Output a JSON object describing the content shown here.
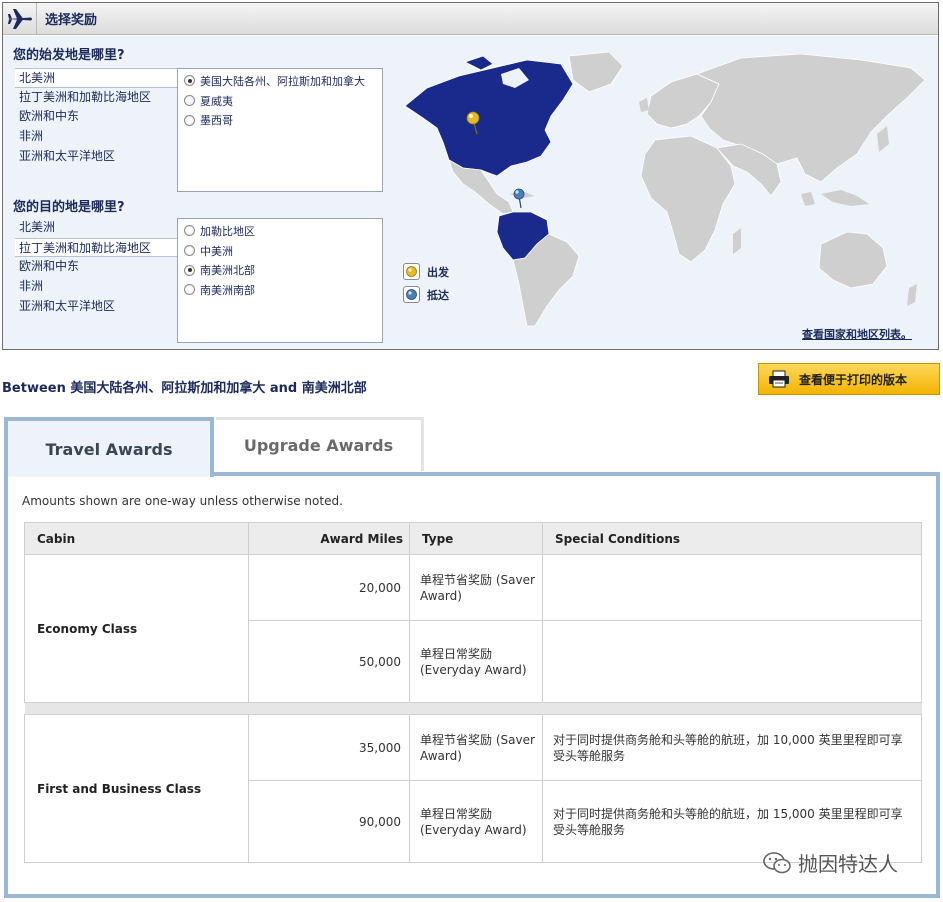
{
  "selector": {
    "title": "选择奖励",
    "origin_question": "您的始发地是哪里?",
    "origin_regions": [
      "北美洲",
      "拉丁美洲和加勒比海地区",
      "欧洲和中东",
      "非洲",
      "亚洲和太平洋地区"
    ],
    "origin_options": [
      {
        "label": "美国大陆各州、阿拉斯加和加拿大",
        "checked": true
      },
      {
        "label": "夏威夷",
        "checked": false
      },
      {
        "label": "墨西哥",
        "checked": false
      }
    ],
    "dest_question": "您的目的地是哪里?",
    "dest_regions": [
      "北美洲",
      "拉丁美洲和加勒比海地区",
      "欧洲和中东",
      "非洲",
      "亚洲和太平洋地区"
    ],
    "dest_options": [
      {
        "label": "加勒比地区",
        "checked": false
      },
      {
        "label": "中美洲",
        "checked": false
      },
      {
        "label": "南美洲北部",
        "checked": true
      },
      {
        "label": "南美洲南部",
        "checked": false
      }
    ],
    "legend": {
      "depart": "出发",
      "arrive": "抵达"
    },
    "country_list_link": "查看国家和地区列表。",
    "colors": {
      "highlight": "#1a2a8c",
      "land": "#cfcfcf",
      "depart_pin": "#e2b92a",
      "arrive_pin": "#4a80b8"
    }
  },
  "route": "Between 美国大陆各州、阿拉斯加和加拿大 and 南美洲北部",
  "print_button": "查看便于打印的版本",
  "tabs": [
    {
      "label": "Travel Awards",
      "active": true
    },
    {
      "label": "Upgrade Awards",
      "active": false
    }
  ],
  "note": "Amounts shown are one-way unless otherwise noted.",
  "table": {
    "headers": {
      "cabin": "Cabin",
      "miles": "Award Miles",
      "type": "Type",
      "conditions": "Special Conditions"
    },
    "groups": [
      {
        "cabin": "Economy Class",
        "rows": [
          {
            "miles": "20,000",
            "type": "单程节省奖励 (Saver Award)",
            "conditions": ""
          },
          {
            "miles": "50,000",
            "type": "单程日常奖励 (Everyday Award)",
            "conditions": ""
          }
        ]
      },
      {
        "cabin": "First and Business Class",
        "rows": [
          {
            "miles": "35,000",
            "type": "单程节省奖励 (Saver Award)",
            "conditions": "对于同时提供商务舱和头等舱的航班，加 10,000 英里里程即可享受头等舱服务"
          },
          {
            "miles": "90,000",
            "type": "单程日常奖励 (Everyday Award)",
            "conditions": "对于同时提供商务舱和头等舱的航班，加 15,000 英里里程即可享受头等舱服务"
          }
        ]
      }
    ]
  },
  "watermark": "抛因特达人"
}
